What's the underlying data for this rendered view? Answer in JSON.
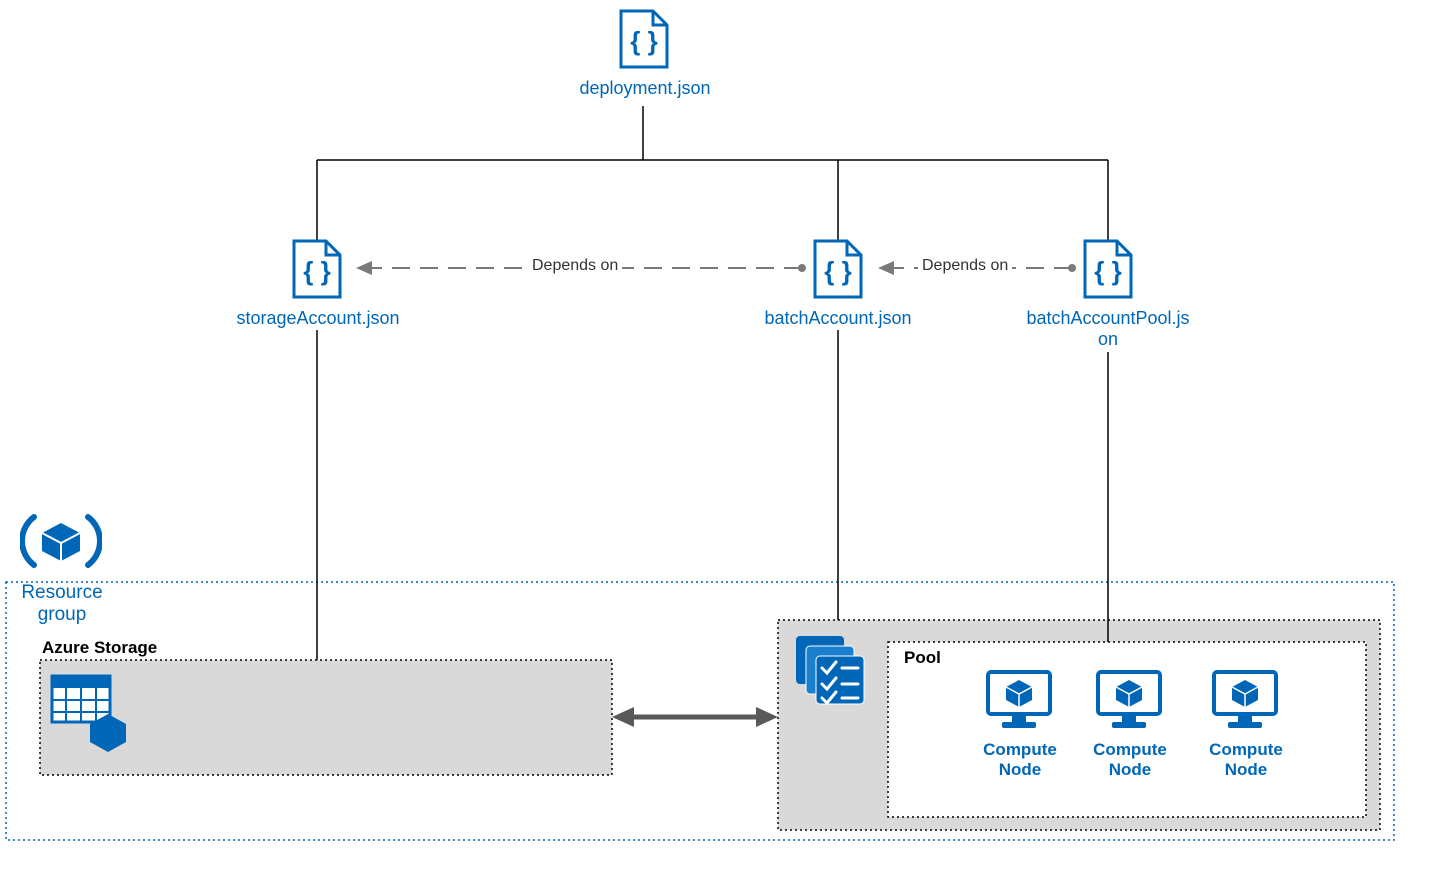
{
  "deployment": {
    "label": "deployment.json"
  },
  "storageAccount": {
    "label": "storageAccount.json"
  },
  "batchAccount": {
    "label": "batchAccount.json"
  },
  "batchAccountPool": {
    "label": "batchAccountPool.js\non"
  },
  "dependsOn1": "Depends on",
  "dependsOn2": "Depends on",
  "resourceGroup": {
    "label": "Resource\ngroup"
  },
  "azureStorage": {
    "label": "Azure Storage"
  },
  "pool": {
    "label": "Pool"
  },
  "computeNode1": "Compute\nNode",
  "computeNode2": "Compute\nNode",
  "computeNode3": "Compute\nNode",
  "colors": {
    "azureBlue": "#0067b8",
    "grayFill": "#d9d9d9",
    "arrowGray": "#595959"
  }
}
